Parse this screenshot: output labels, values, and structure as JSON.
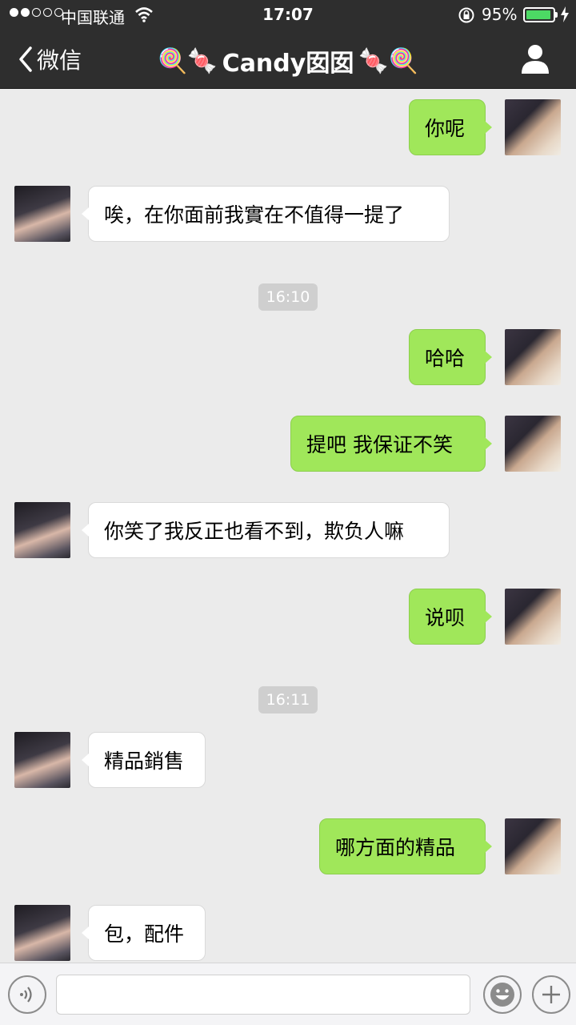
{
  "status_bar": {
    "carrier": "中国联通",
    "time": "17:07",
    "battery": "95%",
    "battery_level": 0.95,
    "signal_bars": 2
  },
  "nav": {
    "back_label": "微信",
    "title": "Candy囡囡",
    "title_left_emoji": "🍭🍬",
    "title_right_emoji": "🍬🍭"
  },
  "messages": [
    {
      "from": "me",
      "text": "你呢"
    },
    {
      "from": "her",
      "text": "唉，在你面前我實在不值得一提了"
    },
    {
      "type": "time",
      "text": "16:10"
    },
    {
      "from": "me",
      "text": "哈哈"
    },
    {
      "from": "me",
      "text": "提吧 我保证不笑"
    },
    {
      "from": "her",
      "text": "你笑了我反正也看不到，欺负人嘛"
    },
    {
      "from": "me",
      "text": "说呗"
    },
    {
      "type": "time",
      "text": "16:11"
    },
    {
      "from": "her",
      "text": "精品銷售"
    },
    {
      "from": "me",
      "text": "哪方面的精品"
    },
    {
      "from": "her",
      "text": "包，配件"
    }
  ],
  "input": {
    "placeholder": ""
  },
  "icons": {
    "back": "chevron-left-icon",
    "contact": "person-icon",
    "voice": "voice-icon",
    "emoji": "smiley-icon",
    "more": "plus-icon"
  },
  "colors": {
    "nav_bg": "#2e2e2e",
    "chat_bg": "#ebebeb",
    "my_bubble": "#a0e75a",
    "their_bubble": "#ffffff",
    "battery": "#4cd964"
  }
}
